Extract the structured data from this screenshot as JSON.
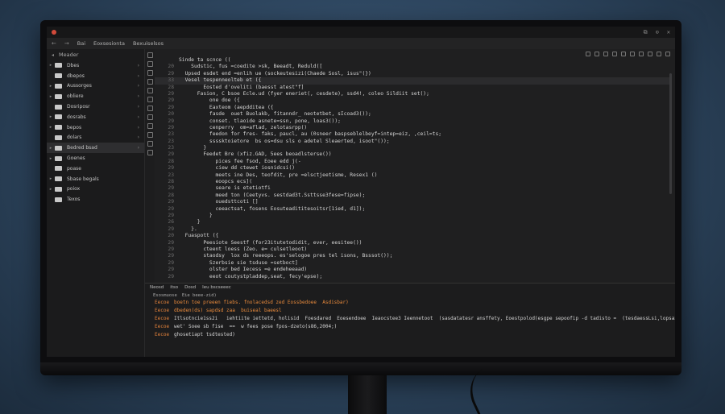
{
  "window": {
    "title_controls": [
      "⧉",
      "⊙",
      "✕"
    ]
  },
  "menubar": {
    "nav_back": "←",
    "nav_forward": "→",
    "items": [
      "Bai",
      "Eoxsesionta",
      "Bexuiselsos"
    ]
  },
  "sidebar": {
    "header": "Meader",
    "items": [
      {
        "label": "Dbes",
        "active": false
      },
      {
        "label": "dbepos",
        "active": false
      },
      {
        "label": "Aussorges",
        "active": false
      },
      {
        "label": "obliere",
        "active": false
      },
      {
        "label": "Dosriposr",
        "active": false
      },
      {
        "label": "dosrabs",
        "active": false
      },
      {
        "label": "bepos",
        "active": false
      },
      {
        "label": "dolars",
        "active": false
      },
      {
        "label": "Bedred bsad",
        "active": true
      },
      {
        "label": "Goenes",
        "active": false
      },
      {
        "label": "poase",
        "active": false
      },
      {
        "label": "Sbase begals",
        "active": false
      },
      {
        "label": "poiox",
        "active": false
      },
      {
        "label": "Texos",
        "active": false
      }
    ]
  },
  "editor": {
    "lines": [
      {
        "n": "",
        "text": "Sinde ta scnce (("
      },
      {
        "n": "20",
        "text": "    Sudstic, fus =coedite >sk, Beeadt, Reduld(["
      },
      {
        "n": "29",
        "text": "  Upsed esdet end =enlih ue (sockeutesizi(Chaede Sosl, isus\"(})"
      },
      {
        "n": "33",
        "text": "  Vesel tespenneolteb et ({",
        "hl": true
      },
      {
        "n": "28",
        "text": "        Eosted d'oveliti (baesst atest\"f]"
      },
      {
        "n": "29",
        "text": "      Fasion, C bsoe Ecle.ud (fyer eneriet(, cesdete), ssd4!, coleo Sildiit set();"
      },
      {
        "n": "29",
        "text": "          one doe ({"
      },
      {
        "n": "29",
        "text": "          Eaxteom (aepdditea ({"
      },
      {
        "n": "20",
        "text": "          fasde  ouet Buolakb, fitanndr_ neotetbet, sIcoad3());"
      },
      {
        "n": "29",
        "text": "          conset. tlaoide asnete=ssn, pone, loas3());"
      },
      {
        "n": "29",
        "text": "          cenperry  om=aflad, zelotasrpp()"
      },
      {
        "n": "23",
        "text": "          feedon for fres- faks, paucl, au (0sneer baspseblelbeyf=intep=eiz, ,ceil=ts;"
      },
      {
        "n": "23",
        "text": "          ssssktoietore  bs os=dsu sls o adetel Sleaerted, isoot\"());"
      },
      {
        "n": "23",
        "text": "        }"
      },
      {
        "n": "29",
        "text": "        Feedet Bre (xfiz.GAD, 5ees beoadlsterse())"
      },
      {
        "n": "28",
        "text": "            pices fee fsod, Eoee edd j(-"
      },
      {
        "n": "29",
        "text": "            ciew dd ctewet iosnidcsi()"
      },
      {
        "n": "23",
        "text": "            meets ine Des, teofdit, pre =elsctjeetisme, Resex1 ()"
      },
      {
        "n": "28",
        "text": "            eoopcs ecs]("
      },
      {
        "n": "29",
        "text": "            seare is etetiotfi"
      },
      {
        "n": "28",
        "text": "            meed ton (Ceetyvs. sestdad3t.Ssttsse3fese=fipse);"
      },
      {
        "n": "29",
        "text": "            ouedsttcoti []"
      },
      {
        "n": "29",
        "text": "            ceeactsat, fosens Eosuteadititesoitsr[1ied, d1]);"
      },
      {
        "n": "29",
        "text": "          }"
      },
      {
        "n": "26",
        "text": "      }"
      },
      {
        "n": "29",
        "text": "    }."
      },
      {
        "n": "20",
        "text": "  Fuaspott ({"
      },
      {
        "n": "29",
        "text": "        Peesiote Seestf (for23itutetodidit, ever, eesitee())"
      },
      {
        "n": "29",
        "text": "        cteent loess (Zeo. e= culsetleoot)"
      },
      {
        "n": "29",
        "text": "        staodsy  lox ds reeeops. es'selogoe pres tel isons, Bsssot());"
      },
      {
        "n": "29",
        "text": "          Szerbsie sie tsduse =setboct]"
      },
      {
        "n": "29",
        "text": "          olster bed Iecess =e endeheeaad)"
      },
      {
        "n": "29",
        "text": "          eeot coutystpladdep,seat, fecy'epse);"
      }
    ]
  },
  "terminal": {
    "tabs": [
      "Neosd",
      "itso",
      "Dosd",
      "Ieu bscseeec"
    ],
    "header": [
      "Esosmuose",
      "Eie beee-zid)"
    ],
    "lines": [
      {
        "pre": "Eecoe",
        "text": "boetn toe preeen fiebs. fnolacedsd zed Eossbedoee  Asdisbar)",
        "w": false
      },
      {
        "pre": "Eecoe",
        "text": "dbeden(ds) sapdsd zaa  buiseal baeesl",
        "w": false
      },
      {
        "pre": "Eecoe",
        "text": "Itlsotncie1ss2i   iehtiite iettetd, holisid  Foesdared  Eoesendoee  Ieaocstee3 Ieennetoot  (sasdatatesr ansffety, Eoestpolod(esgpe sepoofip -d tadisto =  (tesdaessLsi,lopsa3)",
        "w": true
      },
      {
        "pre": "Eecoe",
        "text": "wet' Soee sb fise  ==  w fees pose fpos-dzeto(s86,2004;)",
        "w": true
      },
      {
        "pre": "Eecoe",
        "text": "ghosetiapt tsdtested)",
        "w": true
      }
    ]
  }
}
